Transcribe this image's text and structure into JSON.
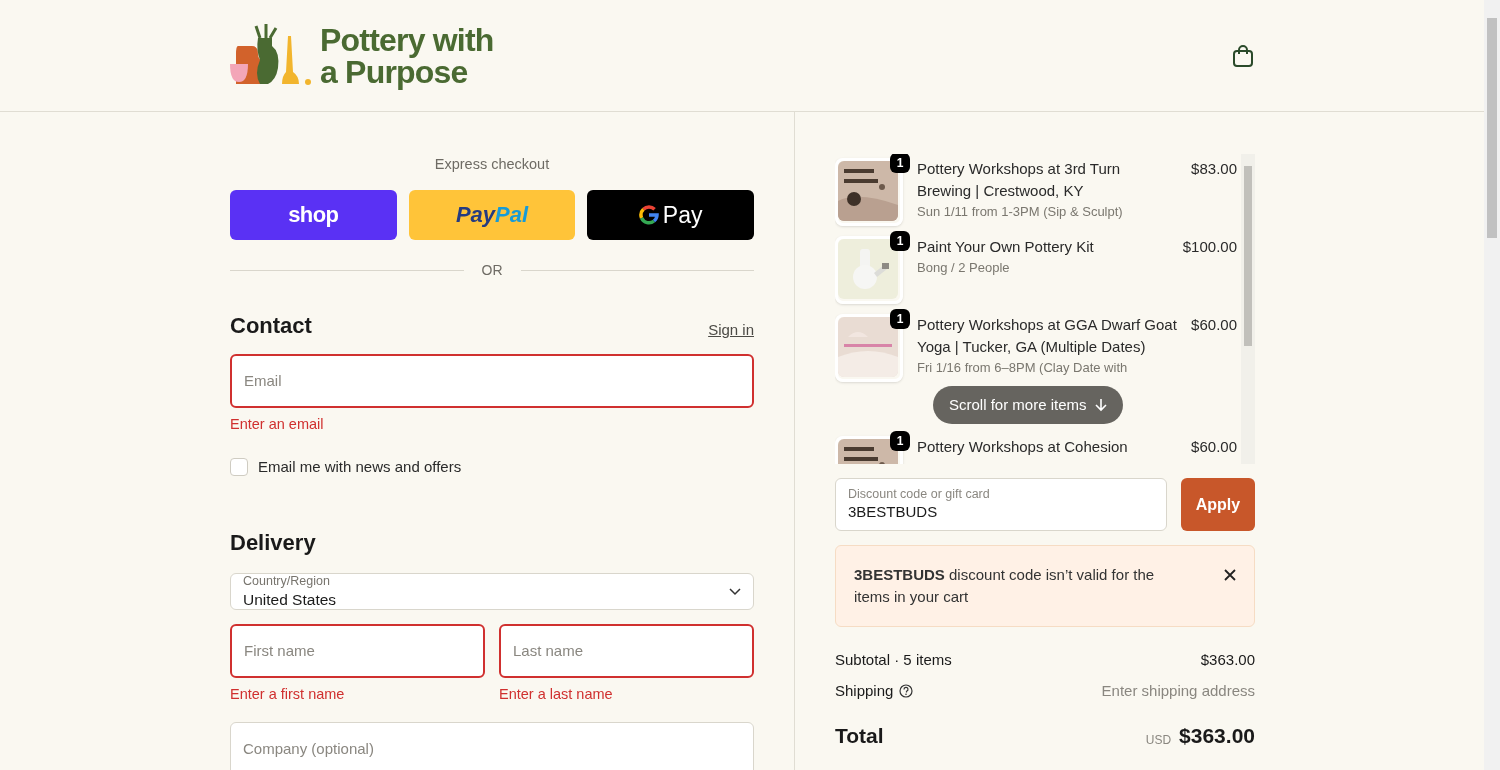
{
  "header": {
    "logo_lines": [
      "Pottery with",
      "a Purpose"
    ]
  },
  "express_checkout": {
    "title": "Express checkout",
    "buttons": [
      {
        "kind": "shop",
        "parts": [
          "shop"
        ]
      },
      {
        "kind": "paypal",
        "parts": [
          "Pay",
          "Pal"
        ]
      },
      {
        "kind": "gpay",
        "parts": [
          "Pay"
        ]
      }
    ],
    "divider": "OR"
  },
  "contact": {
    "title": "Contact",
    "sign_in": "Sign in",
    "email": {
      "placeholder": "Email",
      "invalid": true,
      "error": "Enter an email"
    },
    "newsletter": {
      "label": "Email me with news and offers",
      "checked": false
    }
  },
  "delivery": {
    "title": "Delivery",
    "country": {
      "label": "Country/Region",
      "value": "United States"
    },
    "first_name": {
      "placeholder": "First name",
      "invalid": true,
      "error": "Enter a first name"
    },
    "last_name": {
      "placeholder": "Last name",
      "invalid": true,
      "error": "Enter a last name"
    },
    "company": {
      "placeholder": "Company (optional)",
      "invalid": false
    }
  },
  "cart": {
    "items": [
      {
        "quantity": "1",
        "title": "Pottery Workshops at 3rd Turn Brewing | Crestwood, KY",
        "subtitle": "Sun 1/11 from 1-3PM (Sip & Sculpt)",
        "price": "$83.00"
      },
      {
        "quantity": "1",
        "title": "Paint Your Own Pottery Kit",
        "subtitle": "Bong / 2 People",
        "price": "$100.00"
      },
      {
        "quantity": "1",
        "title": "Pottery Workshops at GGA Dwarf Goat Yoga | Tucker, GA (Multiple Dates)",
        "subtitle": "Fri 1/16 from 6–8PM (Clay Date with",
        "price": "$60.00",
        "scroll_hint": true
      },
      {
        "quantity": "1",
        "title": "Pottery Workshops at Cohesion",
        "price": "$60.00"
      }
    ],
    "scroll_hint": "Scroll for more items"
  },
  "discount": {
    "label": "Discount code or gift card",
    "value": "3BESTBUDS",
    "apply": "Apply"
  },
  "notice": {
    "text": "**3BESTBUDS** discount code isn’t valid for the items in your cart"
  },
  "summary": {
    "subtotal_label": "Subtotal · 5 items",
    "subtotal": "$363.00",
    "shipping_label": "Shipping",
    "shipping": "Enter shipping address",
    "total_label": "Total",
    "currency": "USD",
    "total": "$363.00"
  }
}
